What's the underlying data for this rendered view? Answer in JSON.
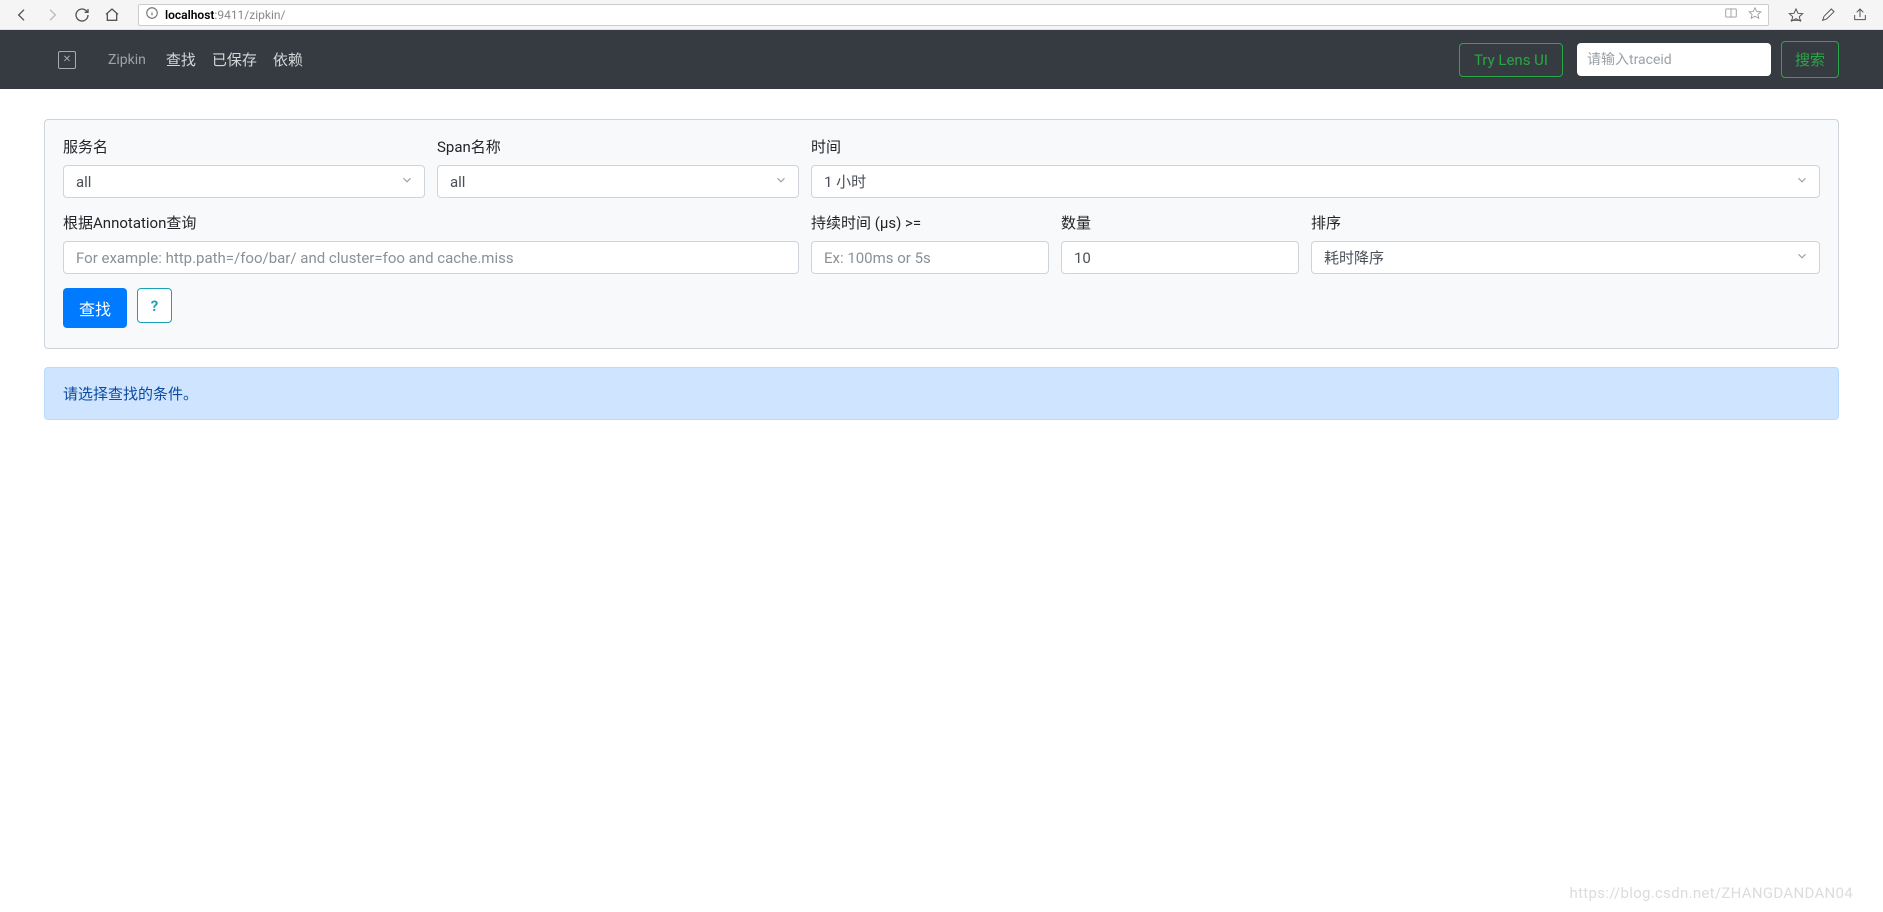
{
  "browser": {
    "url_host": "localhost",
    "url_port_path": ":9411/zipkin/"
  },
  "header": {
    "brand": "Zipkin",
    "nav": {
      "find": "查找",
      "saved": "已保存",
      "deps": "依赖"
    },
    "try_lens": "Try Lens UI",
    "traceid_placeholder": "请输入traceid",
    "search_btn": "搜索"
  },
  "form": {
    "service": {
      "label": "服务名",
      "value": "all"
    },
    "span": {
      "label": "Span名称",
      "value": "all"
    },
    "time": {
      "label": "时间",
      "value": "1 小时"
    },
    "annotation": {
      "label": "根据Annotation查询",
      "placeholder": "For example: http.path=/foo/bar/ and cluster=foo and cache.miss"
    },
    "duration": {
      "label": "持续时间 (µs) >=",
      "placeholder": "Ex: 100ms or 5s"
    },
    "limit": {
      "label": "数量",
      "value": "10"
    },
    "sort": {
      "label": "排序",
      "value": "耗时降序"
    },
    "find_btn": "查找"
  },
  "alert": "请选择查找的条件。",
  "watermark": "https://blog.csdn.net/ZHANGDANDAN04"
}
